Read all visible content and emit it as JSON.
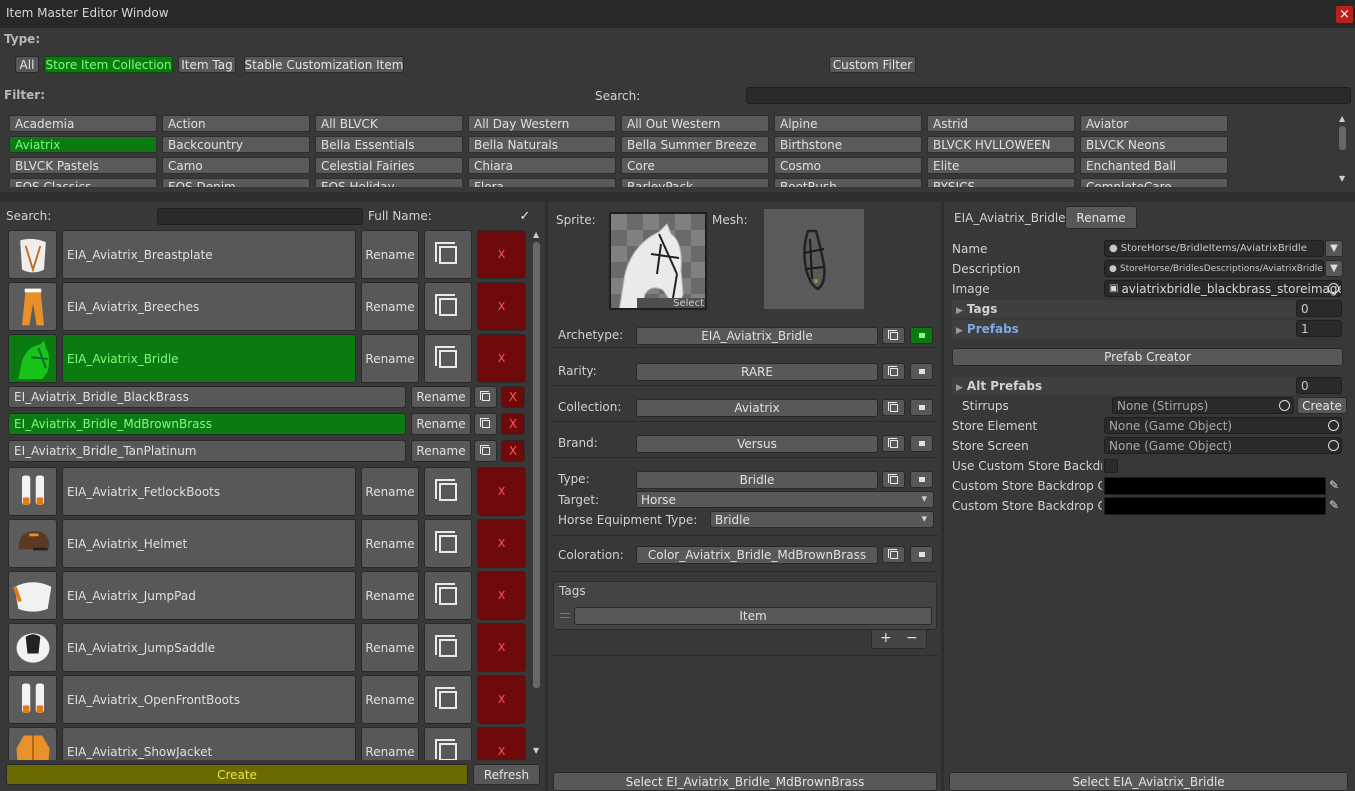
{
  "window": {
    "title": "Item Master Editor Window",
    "close": "×"
  },
  "type": {
    "label": "Type:",
    "buttons": [
      "All",
      "Store Item Collection",
      "Item Tag",
      "Stable Customization Item"
    ],
    "custom_filter": "Custom Filter"
  },
  "filter": {
    "label": "Filter:",
    "search_label": "Search:",
    "items": [
      [
        "Academia",
        "Action",
        "All BLVCK",
        "All Day Western",
        "All Out Western",
        "Alpine",
        "Astrid",
        "Aviator"
      ],
      [
        "Aviatrix",
        "Backcountry",
        "Bella Essentials",
        "Bella Naturals",
        "Bella Summer Breeze",
        "Birthstone",
        "BLVCK HVLLOWEEN",
        "BLVCK Neons"
      ],
      [
        "BLVCK Pastels",
        "Camo",
        "Celestial Fairies",
        "Chiara",
        "Core",
        "Cosmo",
        "Elite",
        "Enchanted Ball"
      ],
      [
        "EOS Classics",
        "EOS Denim",
        "EOS Holiday",
        "Flora",
        "BarleyPack",
        "BootRush",
        "BYSICS",
        "CompleteCare"
      ]
    ],
    "selected": "Aviatrix"
  },
  "list": {
    "search_label": "Search:",
    "fullname_label": "Full Name:",
    "fullname_checked": "✓",
    "rename_label": "Rename",
    "delete_label": "X",
    "items": [
      {
        "name": "EIA_Aviatrix_Breastplate",
        "icon": "breastplate-icon"
      },
      {
        "name": "EIA_Aviatrix_Breeches",
        "icon": "breeches-icon"
      },
      {
        "name": "EIA_Aviatrix_Bridle",
        "icon": "bridle-icon",
        "selected": true
      }
    ],
    "subitems": [
      {
        "name": "EI_Aviatrix_Bridle_BlackBrass"
      },
      {
        "name": "EI_Aviatrix_Bridle_MdBrownBrass",
        "selected": true
      },
      {
        "name": "EI_Aviatrix_Bridle_TanPlatinum"
      }
    ],
    "items2": [
      {
        "name": "EIA_Aviatrix_FetlockBoots",
        "icon": "boots-icon"
      },
      {
        "name": "EIA_Aviatrix_Helmet",
        "icon": "helmet-icon"
      },
      {
        "name": "EIA_Aviatrix_JumpPad",
        "icon": "saddle-pad-icon"
      },
      {
        "name": "EIA_Aviatrix_JumpSaddle",
        "icon": "saddle-icon"
      },
      {
        "name": "EIA_Aviatrix_OpenFrontBoots",
        "icon": "boots-icon"
      },
      {
        "name": "EIA_Aviatrix_ShowJacket",
        "icon": "jacket-icon"
      }
    ],
    "create_label": "Create",
    "refresh_label": "Refresh"
  },
  "middle": {
    "sprite_label": "Sprite:",
    "mesh_label": "Mesh:",
    "select_label": "Select",
    "archetype_label": "Archetype:",
    "archetype_value": "EIA_Aviatrix_Bridle",
    "rarity_label": "Rarity:",
    "rarity_value": "RARE",
    "collection_label": "Collection:",
    "collection_value": "Aviatrix",
    "brand_label": "Brand:",
    "brand_value": "Versus",
    "type_label": "Type:",
    "type_value": "Bridle",
    "target_label": "Target:",
    "target_value": "Horse",
    "equip_label": "Horse Equipment Type:",
    "equip_value": "Bridle",
    "coloration_label": "Coloration:",
    "coloration_value": "Color_Aviatrix_Bridle_MdBrownBrass",
    "tags_label": "Tags",
    "tag_item": "Item",
    "plus": "+",
    "minus": "−",
    "select_button": "Select EI_Aviatrix_Bridle_MdBrownBrass"
  },
  "right": {
    "title": "EIA_Aviatrix_Bridle",
    "rename": "Rename",
    "name_label": "Name",
    "name_value": "StoreHorse/BridleItems/AviatrixBridle",
    "desc_label": "Description",
    "desc_value": "StoreHorse/BridlesDescriptions/AviatrixBridle",
    "image_label": "Image",
    "image_value": "aviatrixbridle_blackbrass_storeimage",
    "tags_label": "Tags",
    "tags_count": "0",
    "prefabs_label": "Prefabs",
    "prefabs_count": "1",
    "prefab_creator": "Prefab Creator",
    "alt_prefabs_label": "Alt Prefabs",
    "alt_prefabs_count": "0",
    "stirrups_label": "Stirrups",
    "stirrups_value": "None (Stirrups)",
    "create": "Create",
    "store_element_label": "Store Element",
    "store_element_value": "None (Game Object)",
    "store_screen_label": "Store Screen",
    "store_screen_value": "None (Game Object)",
    "use_custom_label": "Use Custom Store Backdro",
    "custom_bd1_label": "Custom Store Backdrop Co",
    "custom_bd2_label": "Custom Store Backdrop Co",
    "select_button": "Select EIA_Aviatrix_Bridle"
  },
  "colors": {
    "accent_green": "#0b7a12",
    "delete_red": "#6e0a0a",
    "create_yellow": "#6b6a00"
  }
}
